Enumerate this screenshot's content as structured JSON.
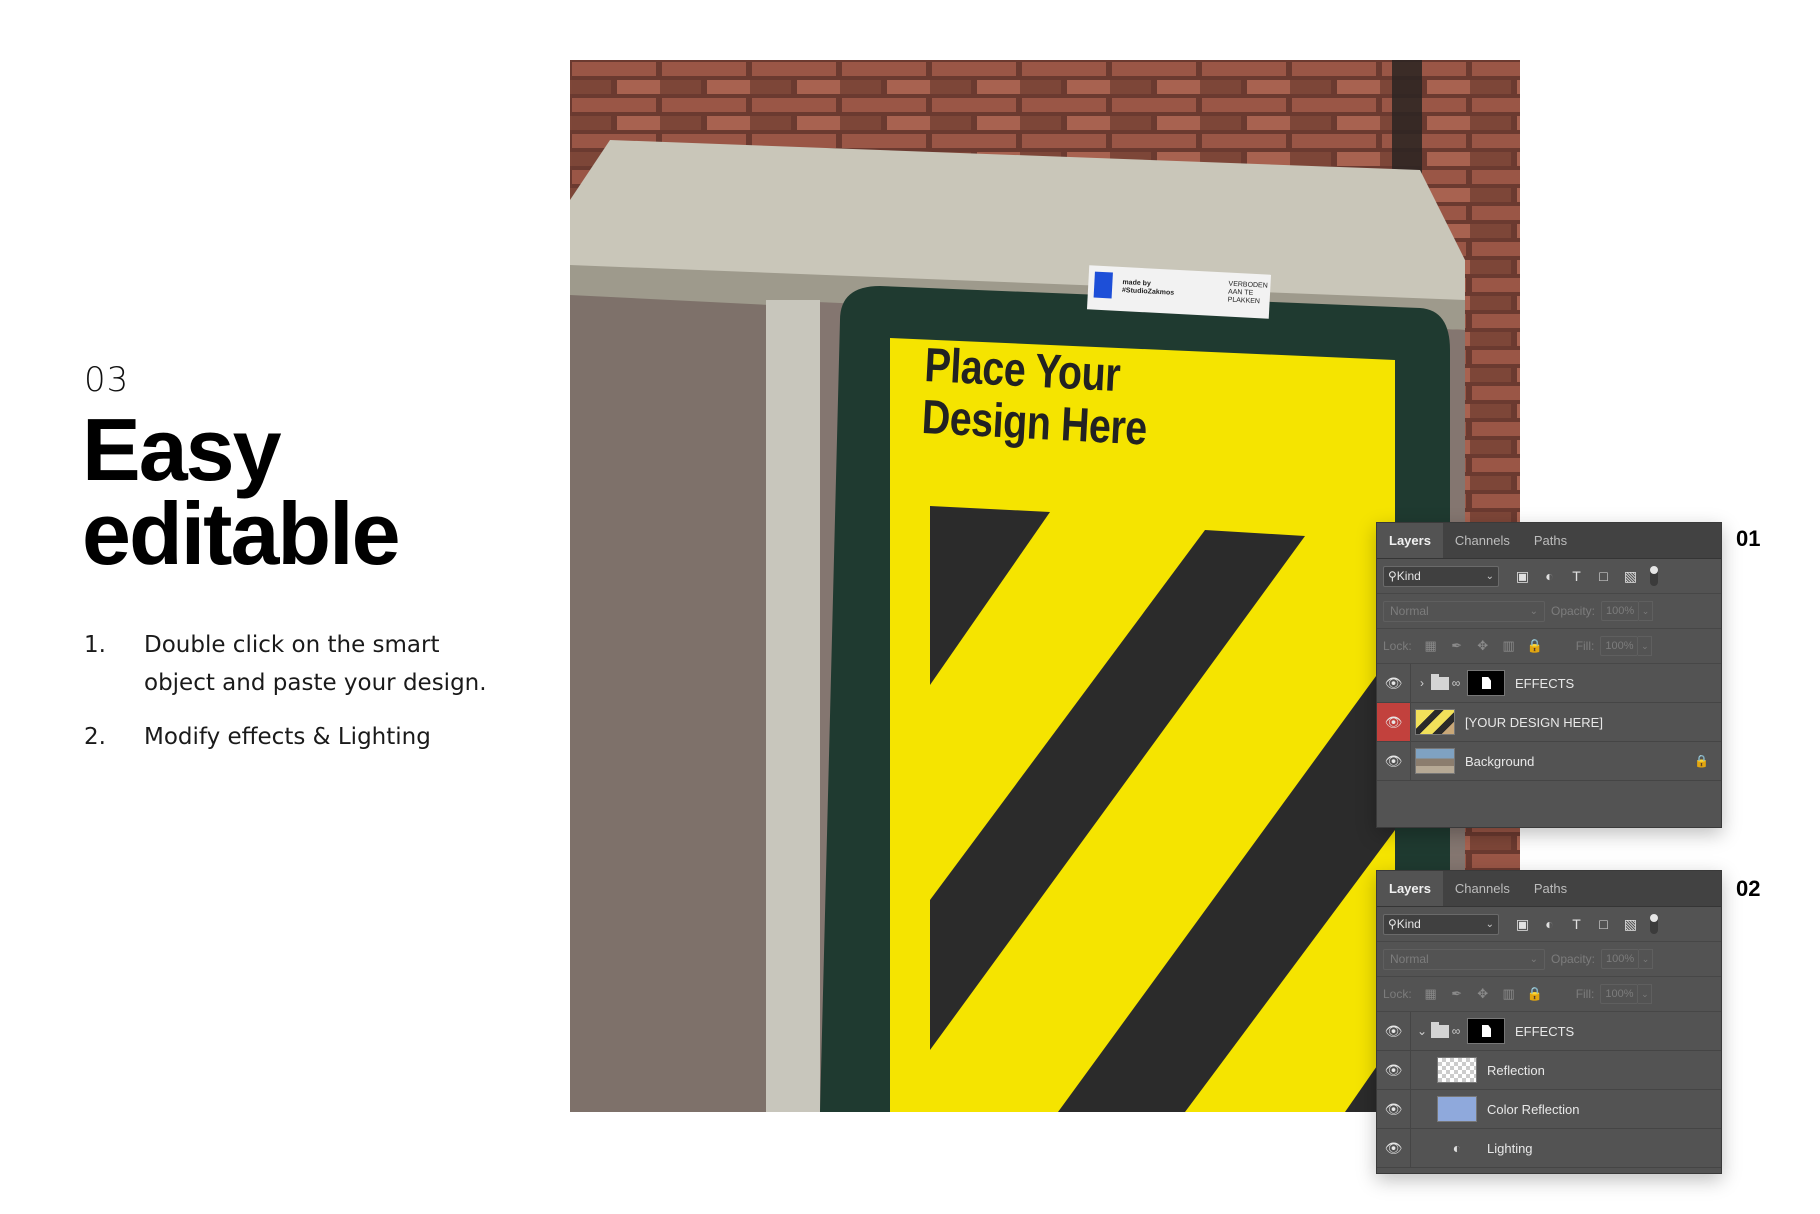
{
  "intro": {
    "step_number": "03",
    "heading_line1": "Easy",
    "heading_line2": "editable",
    "steps": [
      {
        "num": "1.",
        "text": "Double click on the smart object and paste your design."
      },
      {
        "num": "2.",
        "text": "Modify effects & Lighting"
      }
    ]
  },
  "photo": {
    "poster_title_line1": "Place Your",
    "poster_title_line2": "Design Here",
    "sticker_text": "made by #StudioZakmos",
    "sticker_notice": "VERBODEN AAN TE PLAKKEN",
    "poster_color": "#f5e400",
    "stripe_color": "#2b2b2b"
  },
  "panel1": {
    "label": "01",
    "tabs": [
      "Layers",
      "Channels",
      "Paths"
    ],
    "filter_kind": "Kind",
    "blend_mode": "Normal",
    "opacity_label": "Opacity:",
    "opacity_value": "100%",
    "lock_label": "Lock:",
    "fill_label": "Fill:",
    "fill_value": "100%",
    "layers": [
      {
        "name": "EFFECTS"
      },
      {
        "name": "[YOUR DESIGN HERE]"
      },
      {
        "name": "Background"
      }
    ]
  },
  "panel2": {
    "label": "02",
    "tabs": [
      "Layers",
      "Channels",
      "Paths"
    ],
    "filter_kind": "Kind",
    "blend_mode": "Normal",
    "opacity_label": "Opacity:",
    "opacity_value": "100%",
    "lock_label": "Lock:",
    "fill_label": "Fill:",
    "fill_value": "100%",
    "layers": [
      {
        "name": "EFFECTS"
      },
      {
        "name": "Reflection"
      },
      {
        "name": "Color Reflection"
      },
      {
        "name": "Lighting"
      }
    ]
  }
}
